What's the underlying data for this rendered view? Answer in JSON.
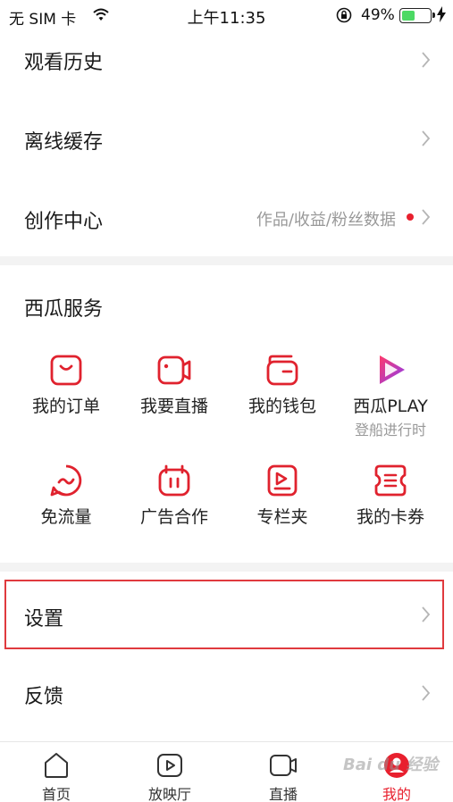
{
  "status_bar": {
    "carrier": "无 SIM 卡",
    "time": "上午11:35",
    "battery_percent": "49%",
    "battery_level": 0.49,
    "icons": [
      "wifi-icon",
      "orientation-lock-icon",
      "battery-icon",
      "charging-bolt-icon"
    ]
  },
  "menu": {
    "watch_history": "观看历史",
    "offline_cache": "离线缓存",
    "creator_center": "创作中心",
    "creator_center_sub": "作品/收益/粉丝数据"
  },
  "services": {
    "title": "西瓜服务",
    "items": [
      {
        "label": "我的订单",
        "icon": "order-icon"
      },
      {
        "label": "我要直播",
        "icon": "live-camera-icon"
      },
      {
        "label": "我的钱包",
        "icon": "wallet-icon"
      },
      {
        "label": "西瓜PLAY",
        "caption": "登船进行时",
        "icon": "xigua-play-icon"
      },
      {
        "label": "免流量",
        "icon": "free-data-icon"
      },
      {
        "label": "广告合作",
        "icon": "ad-cooperation-icon"
      },
      {
        "label": "专栏夹",
        "icon": "column-folder-icon"
      },
      {
        "label": "我的卡券",
        "icon": "coupon-icon"
      }
    ]
  },
  "settings": {
    "label": "设置"
  },
  "feedback": {
    "label": "反馈"
  },
  "tab_bar": {
    "tabs": [
      {
        "label": "首页",
        "icon": "home-icon"
      },
      {
        "label": "放映厅",
        "icon": "play-icon"
      },
      {
        "label": "直播",
        "icon": "live-icon"
      },
      {
        "label": "我的",
        "icon": "profile-icon",
        "active": true
      }
    ]
  },
  "watermark": "Bai du 经验",
  "colors": {
    "accent": "#e8202e",
    "highlight_border": "#e03a3e",
    "divider": "#f3f3f3"
  }
}
